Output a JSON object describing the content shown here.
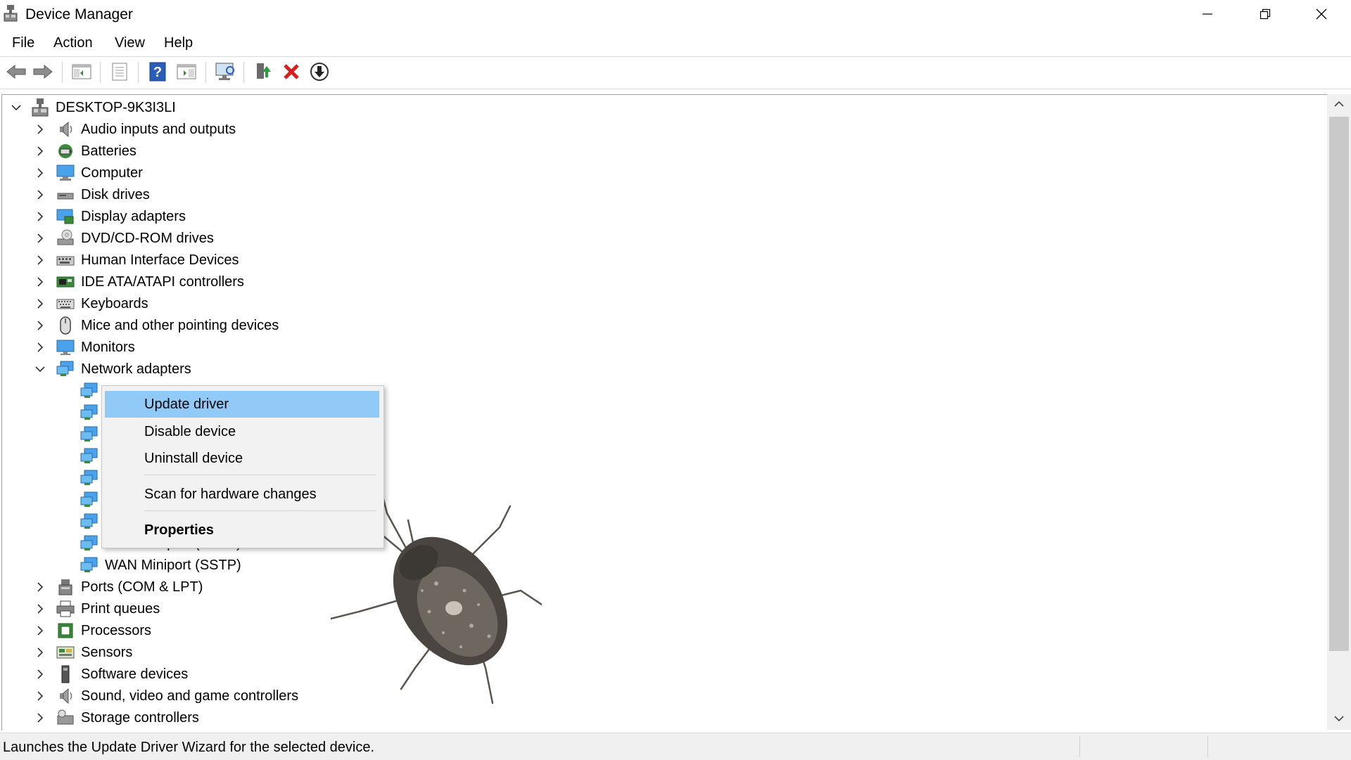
{
  "window": {
    "title": "Device Manager",
    "buttons": [
      "minimize",
      "restore",
      "close"
    ]
  },
  "menubar": {
    "items": [
      "File",
      "Action",
      "View",
      "Help"
    ]
  },
  "toolbar": {
    "buttons": [
      "back-icon",
      "forward-icon",
      "show-hide-console-tree-icon",
      "properties-icon",
      "help-icon",
      "action-pane-icon",
      "monitor-icon",
      "update-driver-icon",
      "uninstall-icon",
      "download-icon"
    ]
  },
  "tree": {
    "root": "DESKTOP-9K3I3LI",
    "categories": [
      {
        "label": "Audio inputs and outputs",
        "icon": "speaker-icon"
      },
      {
        "label": "Batteries",
        "icon": "battery-icon"
      },
      {
        "label": "Computer",
        "icon": "computer-icon"
      },
      {
        "label": "Disk drives",
        "icon": "disk-drive-icon"
      },
      {
        "label": "Display adapters",
        "icon": "display-adapter-icon"
      },
      {
        "label": "DVD/CD-ROM drives",
        "icon": "dvd-drive-icon"
      },
      {
        "label": "Human Interface Devices",
        "icon": "hid-icon"
      },
      {
        "label": "IDE ATA/ATAPI controllers",
        "icon": "ide-controller-icon"
      },
      {
        "label": "Keyboards",
        "icon": "keyboard-icon"
      },
      {
        "label": "Mice and other pointing devices",
        "icon": "mouse-icon"
      },
      {
        "label": "Monitors",
        "icon": "monitor-icon"
      },
      {
        "label": "Network adapters",
        "icon": "network-adapter-icon",
        "expanded": true
      }
    ],
    "network_children": [
      {
        "label": "",
        "icon": "network-adapter-icon"
      },
      {
        "label": "",
        "icon": "network-adapter-icon"
      },
      {
        "label": "",
        "icon": "network-adapter-icon"
      },
      {
        "label": "",
        "icon": "network-adapter-icon"
      },
      {
        "label": "",
        "icon": "network-adapter-icon"
      },
      {
        "label": "",
        "icon": "network-adapter-icon"
      },
      {
        "label": "",
        "icon": "network-adapter-icon"
      },
      {
        "label": "WAN Miniport (PPTP)",
        "icon": "network-adapter-icon"
      },
      {
        "label": "WAN Miniport (SSTP)",
        "icon": "network-adapter-icon"
      }
    ],
    "categories_after": [
      {
        "label": "Ports (COM & LPT)",
        "icon": "port-icon"
      },
      {
        "label": "Print queues",
        "icon": "printer-icon"
      },
      {
        "label": "Processors",
        "icon": "processor-icon"
      },
      {
        "label": "Sensors",
        "icon": "sensor-icon"
      },
      {
        "label": "Software devices",
        "icon": "software-device-icon"
      },
      {
        "label": "Sound, video and game controllers",
        "icon": "speaker-icon"
      },
      {
        "label": "Storage controllers",
        "icon": "storage-controller-icon"
      }
    ]
  },
  "context_menu": {
    "items": [
      {
        "label": "Update driver",
        "highlighted": true
      },
      {
        "label": "Disable device"
      },
      {
        "label": "Uninstall device"
      },
      {
        "label": "Scan for hardware changes"
      },
      {
        "label": "Properties",
        "bold": true
      }
    ]
  },
  "statusbar": {
    "text": "Launches the Update Driver Wizard for the selected device."
  },
  "colors": {
    "highlight": "#91c9f7",
    "menu_bg": "#f2f2f2",
    "status_bg": "#f0f0f0"
  }
}
